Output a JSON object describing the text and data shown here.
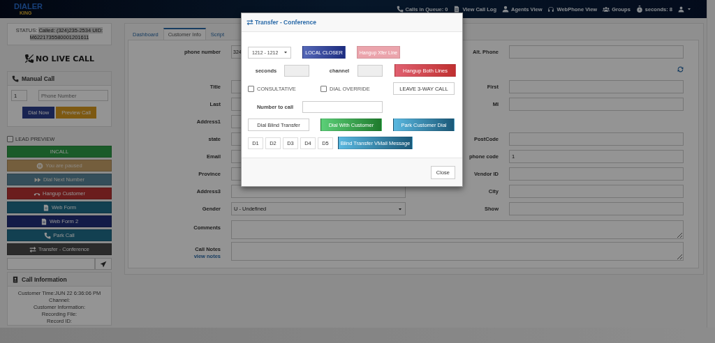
{
  "header": {
    "logo": {
      "title": "DIALER",
      "subtitle": "KING"
    },
    "nav": [
      {
        "kind": "queue",
        "label": "Calls in Queue: 0"
      },
      {
        "kind": "log",
        "label": "View Call Log"
      },
      {
        "kind": "agents",
        "label": "Agents View"
      },
      {
        "kind": "webphone",
        "label": "WebPhone View"
      },
      {
        "kind": "groups",
        "label": "Groups"
      },
      {
        "kind": "timer",
        "label": "seconds: 8"
      }
    ]
  },
  "sidebar": {
    "status": {
      "label": "STATUS:",
      "value": "Called: (324)235-2534 UID: M6221735580001201611"
    },
    "live_call": "NO LIVE CALL",
    "manual_call": {
      "title": "Manual Call",
      "code": "1",
      "phone_placeholder": "Phone Number",
      "buttons": [
        {
          "label": "Dial Now",
          "kind": "primary"
        },
        {
          "label": "Preview Call",
          "kind": "warning"
        }
      ]
    },
    "lead_preview": {
      "label": "LEAD PREVIEW",
      "checked": false
    },
    "actions": [
      {
        "label": "INCALL",
        "kind": "incall",
        "disabled": false
      },
      {
        "label": "You are paused",
        "kind": "paused",
        "disabled": true
      },
      {
        "label": "Dial Next Number",
        "kind": "next",
        "disabled": true
      },
      {
        "label": "Hangup Customer",
        "kind": "hangup",
        "disabled": false
      },
      {
        "label": "Web Form",
        "kind": "form",
        "disabled": false
      },
      {
        "label": "Web Form 2",
        "kind": "form2",
        "disabled": false
      },
      {
        "label": "Park Call",
        "kind": "park",
        "disabled": false
      },
      {
        "label": "Transfer - Conference",
        "kind": "transfer",
        "disabled": false
      }
    ],
    "call_information": {
      "title": "Call Information",
      "lines": [
        "Customer Time:JUN 22 6:36:06 PM",
        "Channel:",
        "Customer Information:",
        "Recording File:",
        "Record ID:"
      ]
    }
  },
  "tabs": [
    {
      "label": "Dashboard",
      "selected": false
    },
    {
      "label": "Customer Info",
      "selected": true
    },
    {
      "label": "Script",
      "selected": false
    }
  ],
  "form": {
    "rows": [
      {
        "left": {
          "label": "phone number",
          "kind": "input",
          "value": "324"
        },
        "right": {
          "label": "Alt. Phone",
          "kind": "input"
        }
      },
      {
        "right": {
          "kind": "refresh"
        }
      },
      {
        "left": {
          "label": "Title",
          "kind": "input"
        },
        "right": {
          "label": "First",
          "kind": "input"
        }
      },
      {
        "left": {
          "label": "Last",
          "kind": "input"
        },
        "right": {
          "label": "MI",
          "kind": "input"
        }
      },
      {
        "left": {
          "label": "Address1",
          "kind": "input"
        }
      },
      {
        "left": {
          "label": "state",
          "kind": "input"
        },
        "right": {
          "label": "PostCode",
          "kind": "input"
        }
      },
      {
        "left": {
          "label": "Email",
          "kind": "input"
        },
        "right": {
          "label": "phone code",
          "kind": "input",
          "value": "1"
        }
      },
      {
        "left": {
          "label": "Province",
          "kind": "input"
        },
        "right": {
          "label": "Vendor ID",
          "kind": "input"
        }
      },
      {
        "left": {
          "label": "Address3",
          "kind": "input"
        },
        "right": {
          "label": "City",
          "kind": "input"
        }
      },
      {
        "left": {
          "label": "Gender",
          "kind": "select",
          "value": "U - Undefined"
        },
        "right": {
          "label": "Show",
          "kind": "input"
        }
      }
    ],
    "comments": {
      "label": "Comments"
    },
    "call_notes": {
      "label": "Call Notes",
      "link": "view notes"
    }
  },
  "modal": {
    "title": "Transfer - Conference",
    "rows": [
      {
        "items": [
          {
            "kind": "select",
            "value": "1212 - 1212"
          },
          {
            "kind": "primary",
            "label": "LOCAL CLOSER",
            "disabled": false
          },
          {
            "kind": "danger",
            "label": "Hangup Xfer Line",
            "disabled": true
          }
        ]
      },
      {
        "items": [
          {
            "kind": "label",
            "label": "seconds"
          },
          {
            "kind": "input",
            "disabled": true
          },
          {
            "kind": "label",
            "label": "channel"
          },
          {
            "kind": "input",
            "disabled": true
          },
          {
            "kind": "danger",
            "label": "Hangup Both Lines",
            "disabled": false
          }
        ]
      },
      {
        "items": [
          {
            "kind": "checkbox",
            "label": "CONSULTATIVE",
            "checked": false
          },
          {
            "kind": "checkbox",
            "label": "DIAL OVERRIDE",
            "checked": false
          },
          {
            "kind": "default",
            "label": "LEAVE 3-WAY CALL",
            "disabled": false
          }
        ]
      },
      {
        "items": [
          {
            "kind": "label",
            "label": "Number to call"
          },
          {
            "kind": "input",
            "disabled": false
          }
        ]
      },
      {
        "items": [
          {
            "kind": "default",
            "label": "Dial Blind Transfer",
            "disabled": false
          },
          {
            "kind": "success",
            "label": "Dial With Customer",
            "disabled": false
          },
          {
            "kind": "info",
            "label": "Park Customer Dial",
            "disabled": false
          }
        ]
      },
      {
        "items": [
          {
            "kind": "digit",
            "label": "D1"
          },
          {
            "kind": "digit",
            "label": "D2"
          },
          {
            "kind": "digit",
            "label": "D3"
          },
          {
            "kind": "digit",
            "label": "D4"
          },
          {
            "kind": "digit",
            "label": "D5"
          },
          {
            "kind": "info",
            "label": "Blind Transfer VMail Message",
            "disabled": false
          }
        ]
      }
    ],
    "close": "Close"
  }
}
